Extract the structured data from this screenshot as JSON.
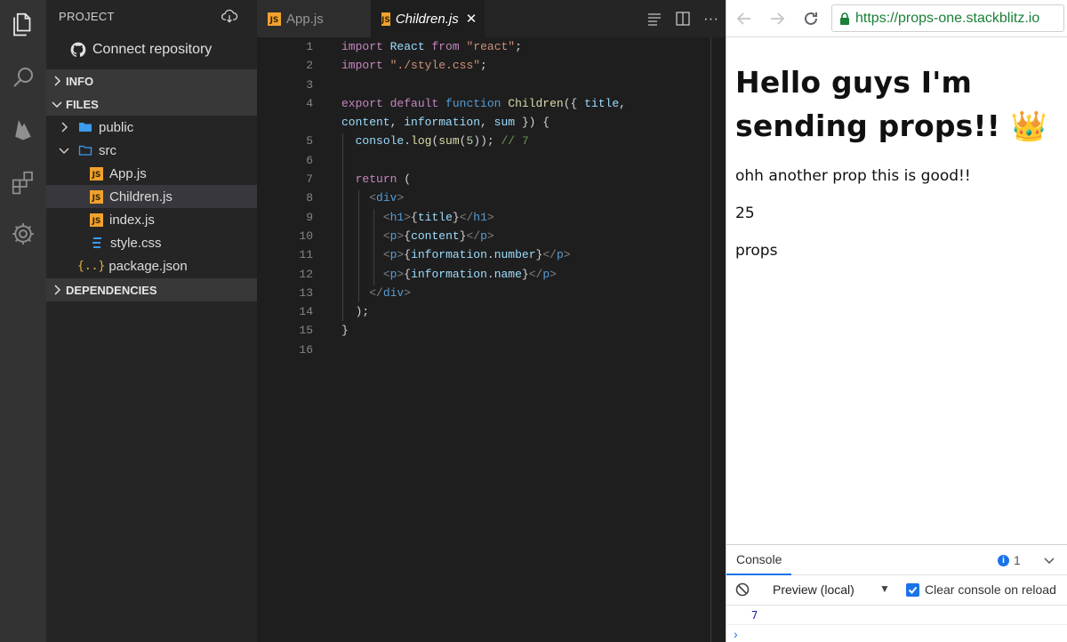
{
  "sidebar": {
    "header": "PROJECT",
    "connect_repo": "Connect repository",
    "sections": {
      "info": "INFO",
      "files": "FILES",
      "dependencies": "DEPENDENCIES"
    },
    "tree": [
      {
        "label": "public",
        "icon": "folder-icon"
      },
      {
        "label": "src",
        "icon": "folder-open-icon"
      },
      {
        "label": "App.js",
        "icon": "js-file-icon"
      },
      {
        "label": "Children.js",
        "icon": "js-file-icon"
      },
      {
        "label": "index.js",
        "icon": "js-file-icon"
      },
      {
        "label": "style.css",
        "icon": "css-file-icon"
      },
      {
        "label": "package.json",
        "icon": "json-file-icon"
      }
    ],
    "js_badge": "JS",
    "json_badge": "{..}"
  },
  "editor": {
    "tabs": [
      {
        "label": "App.js",
        "active": false
      },
      {
        "label": "Children.js",
        "active": true
      }
    ],
    "close_glyph": "✕",
    "more_glyph": "···",
    "line_numbers": [
      "1",
      "2",
      "3",
      "4",
      "",
      "5",
      "6",
      "7",
      "8",
      "9",
      "10",
      "11",
      "12",
      "13",
      "14",
      "15",
      "16"
    ]
  },
  "browser": {
    "url_scheme": "https://",
    "url_host": "props-one.stackblitz.io"
  },
  "preview": {
    "heading": "Hello guys I'm sending props!! 👑",
    "paragraphs": [
      "ohh another prop this is good!!",
      "25",
      "props"
    ]
  },
  "console": {
    "tab_label": "Console",
    "message_count": "1",
    "context": "Preview (local)",
    "clear_on_reload": "Clear console on reload",
    "output": "7",
    "prompt": "›"
  },
  "colors": {
    "activity_bar": "#333333",
    "sidebar": "#252526",
    "editor": "#1e1e1e",
    "js_badge": "#f0a22e",
    "accent": "#1a73e8"
  }
}
